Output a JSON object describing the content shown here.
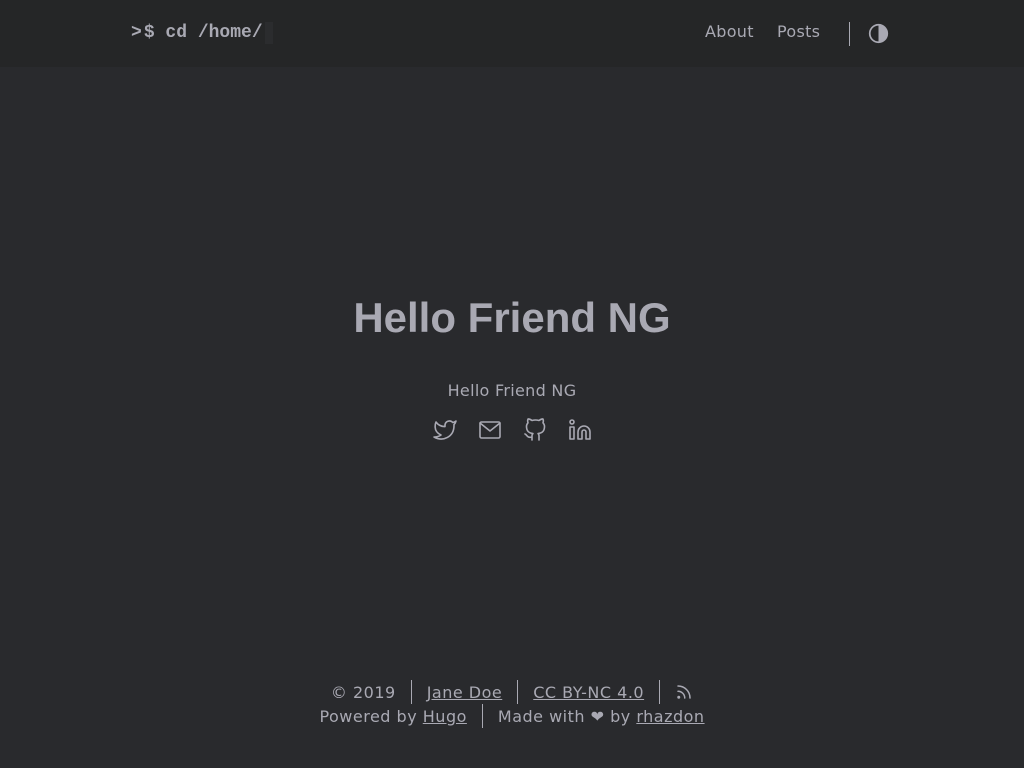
{
  "header": {
    "logo_prompt": ">",
    "logo_text": "$ cd /home/",
    "nav": [
      {
        "label": "About"
      },
      {
        "label": "Posts"
      }
    ]
  },
  "hero": {
    "title": "Hello Friend NG",
    "subtitle": "Hello Friend NG"
  },
  "social": [
    {
      "icon": "twitter-icon"
    },
    {
      "icon": "email-icon"
    },
    {
      "icon": "github-icon"
    },
    {
      "icon": "linkedin-icon"
    }
  ],
  "footer": {
    "copyright": "© 2019",
    "author": "Jane Doe",
    "license": "CC BY-NC 4.0",
    "rss_icon": "rss-icon",
    "powered_prefix": "Powered by ",
    "powered_link": "Hugo",
    "made_with_prefix": "Made with ❤ by ",
    "made_with_link": "rhazdon"
  },
  "colors": {
    "background": "#292a2d",
    "header_background": "#252627",
    "text": "#a9a9b3"
  }
}
